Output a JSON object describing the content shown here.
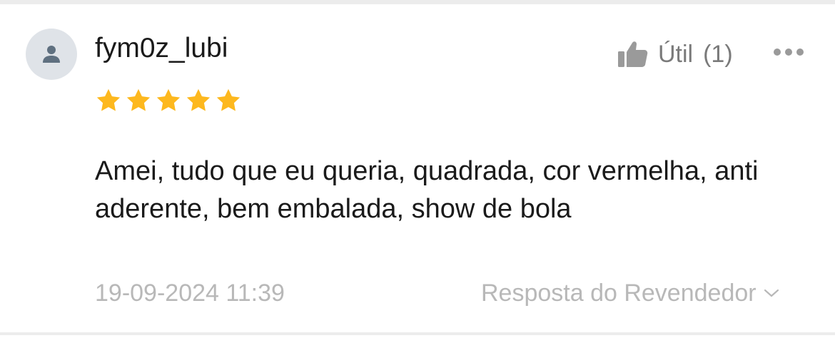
{
  "review": {
    "username": "fym0z_lubi",
    "rating": 5,
    "rating_max": 5,
    "comment": "Amei, tudo que eu queria, quadrada, cor vermelha, anti aderente, bem embalada, show de bola",
    "date": "19-09-2024 11:39"
  },
  "actions": {
    "useful_label": "Útil",
    "useful_count": "(1)",
    "seller_reply_label": "Resposta do Revendedor"
  },
  "icons": {
    "avatar": "user-icon",
    "like": "thumbs-up-icon",
    "more": "more-dots-icon",
    "expand": "chevron-down-icon",
    "star": "star-icon"
  },
  "colors": {
    "star": "#FDB81E",
    "text": "#1A1A1A",
    "muted": "#B8B8B8",
    "icon_gray": "#9A9A9A"
  }
}
